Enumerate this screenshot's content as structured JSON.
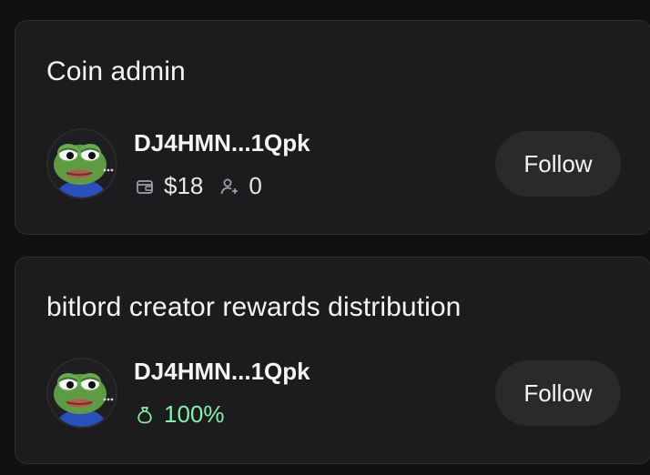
{
  "cards": [
    {
      "title": "Coin admin",
      "user": {
        "name": "DJ4HMN...1Qpk",
        "avatar_icon": "pepe-frog-avatar"
      },
      "stats": {
        "balance": "$18",
        "balance_icon": "wallet-icon",
        "followers": "0",
        "followers_icon": "user-plus-icon"
      },
      "follow_label": "Follow"
    },
    {
      "title": "bitlord creator rewards distribution",
      "user": {
        "name": "DJ4HMN...1Qpk",
        "avatar_icon": "pepe-frog-avatar"
      },
      "share": {
        "percent": "100%",
        "icon": "money-bag-icon",
        "color": "#86efac"
      },
      "follow_label": "Follow"
    }
  ]
}
